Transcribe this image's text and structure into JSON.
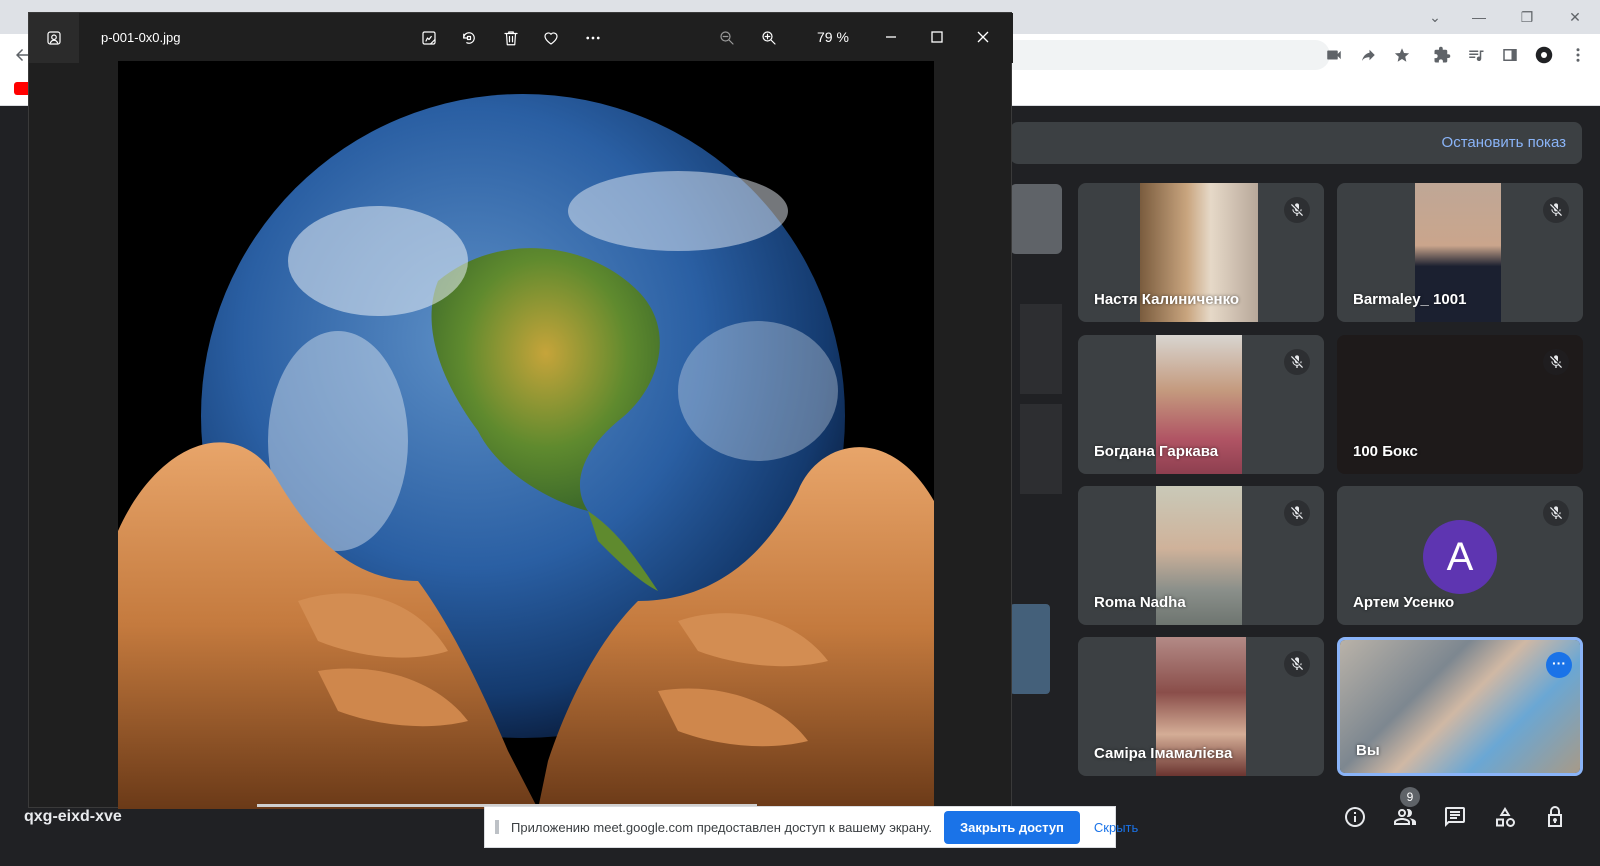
{
  "viewer": {
    "filename": "p-001-0x0.jpg",
    "zoom": "79 %",
    "toolbar": [
      "edit-image-icon",
      "rotate-icon",
      "delete-icon",
      "favorite-icon",
      "more-icon",
      "zoom-out-icon",
      "zoom-in-icon"
    ],
    "window_controls": [
      "minimize",
      "maximize",
      "close"
    ]
  },
  "meet": {
    "stop_presenting": "Остановить показ",
    "meeting_code": "qxg-eixd-xve",
    "participants_count": "9",
    "self_initial": "A",
    "tiles": [
      {
        "name": "Настя Калиниченко",
        "muted": true
      },
      {
        "name": "Barmaley_ 1001",
        "muted": true
      },
      {
        "name": "Богдана Гаркава",
        "muted": true
      },
      {
        "name": "100 Бокс",
        "muted": true
      },
      {
        "name": "Roma Nadha",
        "muted": true
      },
      {
        "name": "Артем Усенко",
        "muted": true
      },
      {
        "name": "Саміра Імамалієва",
        "muted": true
      },
      {
        "name": "Вы",
        "muted": false
      }
    ]
  },
  "share_bar": {
    "message": "Приложению meet.google.com предоставлен доступ к вашему экрану.",
    "stop_button": "Закрыть доступ",
    "hide_link": "Скрыть"
  },
  "colors": {
    "meet_bg": "#202124",
    "tile_bg": "#3c4043",
    "accent_blue": "#1a73e8",
    "link_blue": "#8ab4f8",
    "avatar_purple": "#5e35b1"
  }
}
